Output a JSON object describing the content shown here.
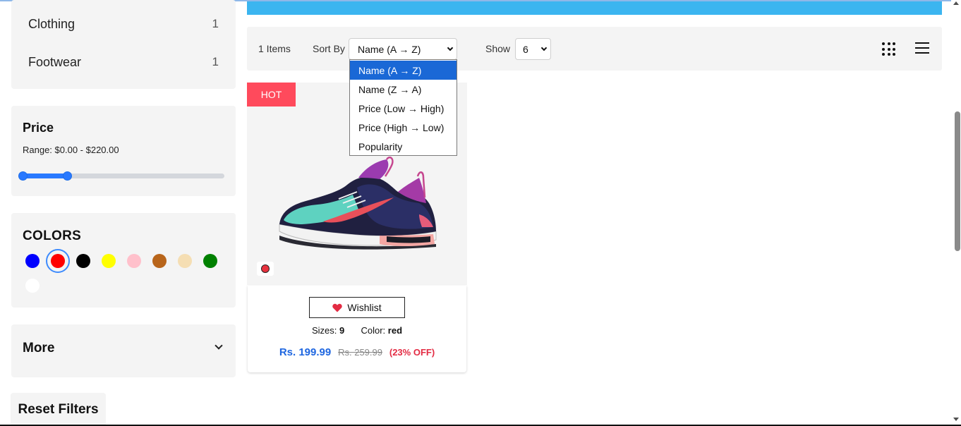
{
  "sidebar": {
    "categories": [
      {
        "label": "Clothing",
        "count": "1"
      },
      {
        "label": "Footwear",
        "count": "1"
      }
    ],
    "price": {
      "title": "Price",
      "range_text": "Range: $0.00 - $220.00",
      "slider_min_fraction": 0,
      "slider_max_fraction": 0.22
    },
    "colors": {
      "title": "COLORS",
      "swatches": [
        "#0000ff",
        "#ff0000",
        "#000000",
        "#ffff00",
        "#ffc0cb",
        "#b8651b",
        "#f5deb3",
        "#008000",
        "#ffffff"
      ],
      "selected": "#ff0000"
    },
    "more": {
      "title": "More"
    },
    "reset_label": "Reset Filters"
  },
  "toolbar": {
    "items_count": "1 Items",
    "sort_label": "Sort By",
    "sort_value": "Name (A → Z)",
    "sort_options": [
      "Name (A → Z)",
      "Name (Z → A)",
      "Price (Low → High)",
      "Price (High → Low)",
      "Popularity"
    ],
    "show_label": "Show",
    "show_value": "6",
    "grid_icon": "grid-icon",
    "list_icon": "list-icon"
  },
  "product": {
    "badge": "HOT",
    "wishlist_label": "Wishlist",
    "sizes_label": "Sizes:",
    "sizes_value": "9",
    "color_label": "Color:",
    "color_value": "red",
    "price_now": "Rs. 199.99",
    "price_old": "Rs. 259.99",
    "discount": "(23% OFF)",
    "swatch_color": "#e8323f"
  },
  "colors": {
    "banner": "#3bb5f0",
    "accent": "#2979ff",
    "hot": "#ff4a5c",
    "price": "#1e66e0",
    "discount": "#e32b43"
  }
}
